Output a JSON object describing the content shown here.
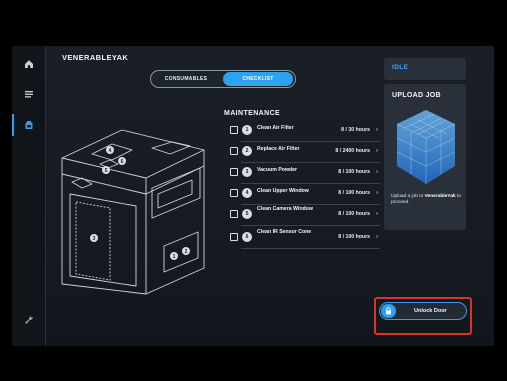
{
  "nav": {
    "items": [
      {
        "name": "home",
        "icon": "home-icon"
      },
      {
        "name": "menu",
        "icon": "list-icon"
      },
      {
        "name": "printer",
        "icon": "printer-icon",
        "active": true
      },
      {
        "name": "settings",
        "icon": "wrench-icon"
      }
    ]
  },
  "printer": {
    "name": "VENERABLEYAK"
  },
  "tabs": {
    "consumables": "CONSUMABLES",
    "checklist": "CHECKLIST",
    "active": "checklist"
  },
  "maintenance": {
    "title": "MAINTENANCE",
    "tasks": [
      {
        "num": "1",
        "name": "Clean Air Filter",
        "hours": "8 / 30 hours"
      },
      {
        "num": "2",
        "name": "Replace Air Filter",
        "hours": "8 / 2400 hours"
      },
      {
        "num": "3",
        "name": "Vacuum Powder",
        "hours": "8 / 100 hours"
      },
      {
        "num": "4",
        "name": "Clean Upper Window",
        "hours": "8 / 100 hours"
      },
      {
        "num": "5",
        "name": "Clean Camera Window",
        "hours": "8 / 100 hours"
      },
      {
        "num": "6",
        "name": "Clean IR Sensor Cone",
        "hours": "8 / 100 hours"
      }
    ],
    "chevron": "›"
  },
  "illustration": {
    "markers": [
      "1",
      "2",
      "3",
      "4",
      "5",
      "6"
    ]
  },
  "status": {
    "label": "IDLE"
  },
  "upload": {
    "title": "UPLOAD JOB",
    "desc_prefix": "Upload a job to",
    "desc_name": "VenerableYak",
    "desc_suffix": "to proceed."
  },
  "door": {
    "label": "Unlock Door"
  },
  "colors": {
    "accent": "#2f9ff0",
    "highlight": "#d9342b",
    "panel": "#2a3039"
  }
}
